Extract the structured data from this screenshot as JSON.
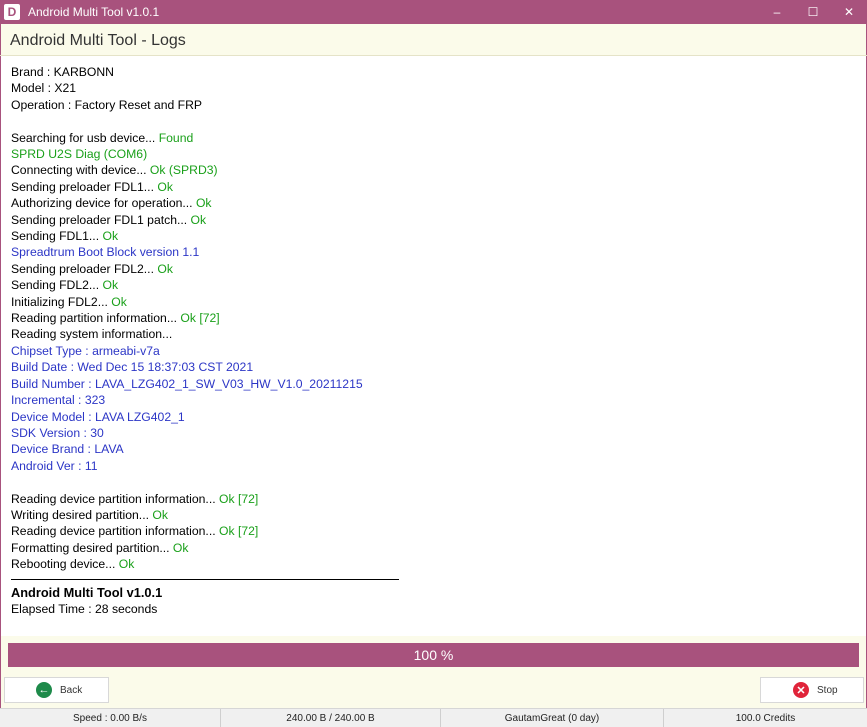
{
  "window": {
    "title": "Android Multi Tool v1.0.1",
    "minimize": "–",
    "maximize": "☐",
    "close": "✕",
    "logo_letter": "D"
  },
  "header": {
    "title": "Android Multi Tool - Logs"
  },
  "log": {
    "brand": "Brand : KARBONN",
    "model": "Model : X21",
    "operation": "Operation : Factory Reset and FRP",
    "lines": [
      {
        "text": "Searching for usb device... ",
        "status": "Found"
      },
      {
        "text": "",
        "status": "SPRD U2S Diag (COM6)"
      },
      {
        "text": "Connecting with device... ",
        "status": "Ok (SPRD3)"
      },
      {
        "text": "Sending preloader FDL1... ",
        "status": "Ok"
      },
      {
        "text": "Authorizing device for operation... ",
        "status": "Ok"
      },
      {
        "text": "Sending preloader FDL1 patch... ",
        "status": "Ok"
      },
      {
        "text": "Sending FDL1... ",
        "status": "Ok"
      },
      {
        "text": "Spreadtrum Boot Block version 1.1"
      },
      {
        "text": "Sending preloader FDL2... ",
        "status": "Ok"
      },
      {
        "text": "Sending FDL2... ",
        "status": "Ok"
      },
      {
        "text": "Initializing FDL2... ",
        "status": "Ok"
      },
      {
        "text": "Reading partition information... ",
        "status": "Ok [72]"
      },
      {
        "text": "Reading system information..."
      }
    ],
    "info": [
      "Chipset Type : armeabi-v7a",
      "Build Date : Wed Dec 15 18:37:03 CST 2021",
      "Build Number : LAVA_LZG402_1_SW_V03_HW_V1.0_20211215",
      "Incremental : 323",
      "Device Model : LAVA LZG402_1",
      "SDK Version : 30",
      "Device Brand : LAVA",
      "Android Ver : 11"
    ],
    "ops": [
      {
        "text": "Reading device partition information... ",
        "status": "Ok [72]"
      },
      {
        "text": "Writing desired partition... ",
        "status": "Ok"
      },
      {
        "text": "Reading device partition information... ",
        "status": "Ok [72]"
      },
      {
        "text": "Formatting desired partition... ",
        "status": "Ok"
      },
      {
        "text": "Rebooting device... ",
        "status": "Ok"
      }
    ],
    "footer_title": "Android Multi Tool v1.0.1",
    "elapsed": "Elapsed Time : 28 seconds"
  },
  "progress": {
    "label": "100 %",
    "value": 100
  },
  "buttons": {
    "back": "Back",
    "stop": "Stop"
  },
  "statusbar": {
    "speed": "Speed : 0.00 B/s",
    "transfer": "240.00 B / 240.00 B",
    "user": "GautamGreat (0 day)",
    "credits": "100.0 Credits"
  },
  "colors": {
    "accent": "#a8527d",
    "ok": "#1aa01a",
    "info": "#2c36c6"
  }
}
